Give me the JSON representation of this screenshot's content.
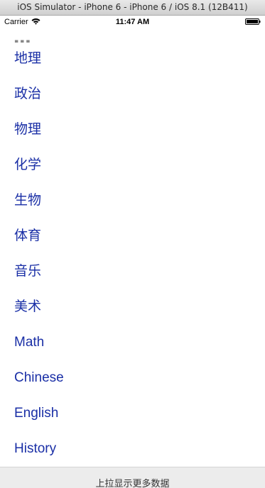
{
  "window": {
    "title": "iOS Simulator - iPhone 6 - iPhone 6 / iOS 8.1 (12B411)"
  },
  "status_bar": {
    "carrier": "Carrier",
    "time": "11:47 AM"
  },
  "list": {
    "items": [
      "地理",
      "政治",
      "物理",
      "化学",
      "生物",
      "体育",
      "音乐",
      "美术",
      "Math",
      "Chinese",
      "English",
      "History"
    ]
  },
  "footer": {
    "load_more_label": "上拉显示更多数据"
  },
  "colors": {
    "item_text": "#1a2fa6",
    "footer_bg": "#ececec"
  }
}
